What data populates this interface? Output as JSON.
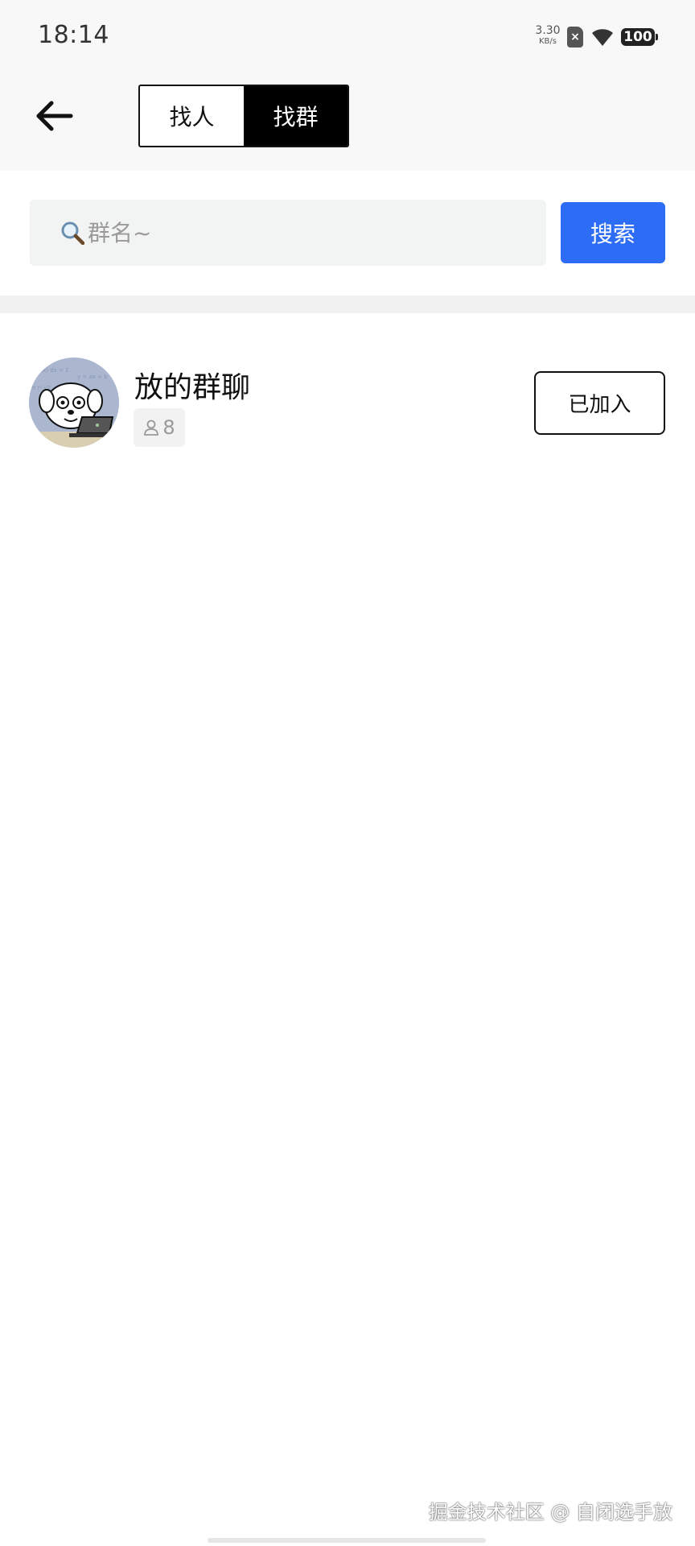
{
  "status_bar": {
    "time": "18:14",
    "net_speed_value": "3.30",
    "net_speed_unit": "KB/s",
    "battery": "100",
    "icons": [
      "sim-disabled-icon",
      "wifi-icon",
      "battery-icon"
    ]
  },
  "nav": {
    "back_icon": "arrow-left-icon",
    "tabs": [
      {
        "label": "找人",
        "active": false
      },
      {
        "label": "找群",
        "active": true
      }
    ]
  },
  "search": {
    "placeholder": "群名~",
    "value": "",
    "icon": "magnifier-icon",
    "button_label": "搜索"
  },
  "results": [
    {
      "name": "放的群聊",
      "member_count": "8",
      "member_icon": "person-icon",
      "action_label": "已加入"
    }
  ],
  "watermark": "掘金技术社区 @ 自闭选手放",
  "colors": {
    "accent": "#2d6df5",
    "nav_background": "#f8f8f8",
    "search_background": "#f2f4f3",
    "divider": "#f1f1f1"
  }
}
